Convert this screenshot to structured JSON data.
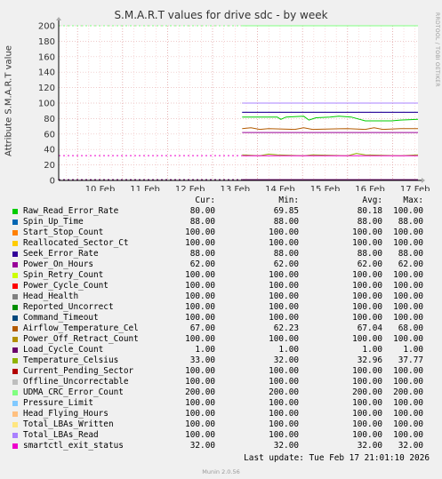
{
  "side_label": "RRDTOOL / TOBI OETIKER",
  "chart_data": {
    "type": "line",
    "title": "S.M.A.R.T values for drive sdc - by week",
    "ylabel": "Attribute S.M.A.R.T value",
    "ylim": [
      0,
      200
    ],
    "yticks": [
      0,
      20,
      40,
      60,
      80,
      100,
      120,
      140,
      160,
      180,
      200
    ],
    "xlabels": [
      "10 Feb",
      "11 Feb",
      "12 Feb",
      "13 Feb",
      "14 Feb",
      "15 Feb",
      "16 Feb",
      "17 Feb"
    ],
    "grid": true,
    "data_start_label": "13 Feb"
  },
  "legend": {
    "headers": [
      "Cur:",
      "Min:",
      "Avg:",
      "Max:"
    ],
    "items": [
      {
        "name": "Raw_Read_Error_Rate",
        "color": "#00cc00",
        "cur": "80.00",
        "min": "69.85",
        "avg": "80.18",
        "max": "100.00"
      },
      {
        "name": "Spin_Up_Time",
        "color": "#0066b3",
        "cur": "88.00",
        "min": "88.00",
        "avg": "88.00",
        "max": "88.00"
      },
      {
        "name": "Start_Stop_Count",
        "color": "#ff8000",
        "cur": "100.00",
        "min": "100.00",
        "avg": "100.00",
        "max": "100.00"
      },
      {
        "name": "Reallocated_Sector_Ct",
        "color": "#ffcc00",
        "cur": "100.00",
        "min": "100.00",
        "avg": "100.00",
        "max": "100.00"
      },
      {
        "name": "Seek_Error_Rate",
        "color": "#330099",
        "cur": "88.00",
        "min": "88.00",
        "avg": "88.00",
        "max": "88.00"
      },
      {
        "name": "Power_On_Hours",
        "color": "#990099",
        "cur": "62.00",
        "min": "62.00",
        "avg": "62.00",
        "max": "62.00"
      },
      {
        "name": "Spin_Retry_Count",
        "color": "#ccff00",
        "cur": "100.00",
        "min": "100.00",
        "avg": "100.00",
        "max": "100.00"
      },
      {
        "name": "Power_Cycle_Count",
        "color": "#ff0000",
        "cur": "100.00",
        "min": "100.00",
        "avg": "100.00",
        "max": "100.00"
      },
      {
        "name": "Head_Health",
        "color": "#808080",
        "cur": "100.00",
        "min": "100.00",
        "avg": "100.00",
        "max": "100.00"
      },
      {
        "name": "Reported_Uncorrect",
        "color": "#008f00",
        "cur": "100.00",
        "min": "100.00",
        "avg": "100.00",
        "max": "100.00"
      },
      {
        "name": "Command_Timeout",
        "color": "#00487d",
        "cur": "100.00",
        "min": "100.00",
        "avg": "100.00",
        "max": "100.00"
      },
      {
        "name": "Airflow_Temperature_Cel",
        "color": "#b35a00",
        "cur": "67.00",
        "min": "62.23",
        "avg": "67.04",
        "max": "68.00"
      },
      {
        "name": "Power_Off_Retract_Count",
        "color": "#b38f00",
        "cur": "100.00",
        "min": "100.00",
        "avg": "100.00",
        "max": "100.00"
      },
      {
        "name": "Load_Cycle_Count",
        "color": "#6b006b",
        "cur": "1.00",
        "min": "1.00",
        "avg": "1.00",
        "max": "1.00"
      },
      {
        "name": "Temperature_Celsius",
        "color": "#8fb300",
        "cur": "33.00",
        "min": "32.00",
        "avg": "32.96",
        "max": "37.77"
      },
      {
        "name": "Current_Pending_Sector",
        "color": "#b30000",
        "cur": "100.00",
        "min": "100.00",
        "avg": "100.00",
        "max": "100.00"
      },
      {
        "name": "Offline_Uncorrectable",
        "color": "#bebebe",
        "cur": "100.00",
        "min": "100.00",
        "avg": "100.00",
        "max": "100.00"
      },
      {
        "name": "UDMA_CRC_Error_Count",
        "color": "#80ff80",
        "cur": "200.00",
        "min": "200.00",
        "avg": "200.00",
        "max": "200.00"
      },
      {
        "name": "Pressure_Limit",
        "color": "#80c9ff",
        "cur": "100.00",
        "min": "100.00",
        "avg": "100.00",
        "max": "100.00"
      },
      {
        "name": "Head_Flying_Hours",
        "color": "#ffc080",
        "cur": "100.00",
        "min": "100.00",
        "avg": "100.00",
        "max": "100.00"
      },
      {
        "name": "Total_LBAs_Written",
        "color": "#ffe680",
        "cur": "100.00",
        "min": "100.00",
        "avg": "100.00",
        "max": "100.00"
      },
      {
        "name": "Total_LBAs_Read",
        "color": "#aa80ff",
        "cur": "100.00",
        "min": "100.00",
        "avg": "100.00",
        "max": "100.00"
      },
      {
        "name": "smartctl_exit_status",
        "color": "#ee00cc",
        "cur": "32.00",
        "min": "32.00",
        "avg": "32.00",
        "max": "32.00"
      }
    ]
  },
  "last_update": "Last update: Tue Feb 17 21:01:10 2026",
  "version": "Munin 2.0.56"
}
